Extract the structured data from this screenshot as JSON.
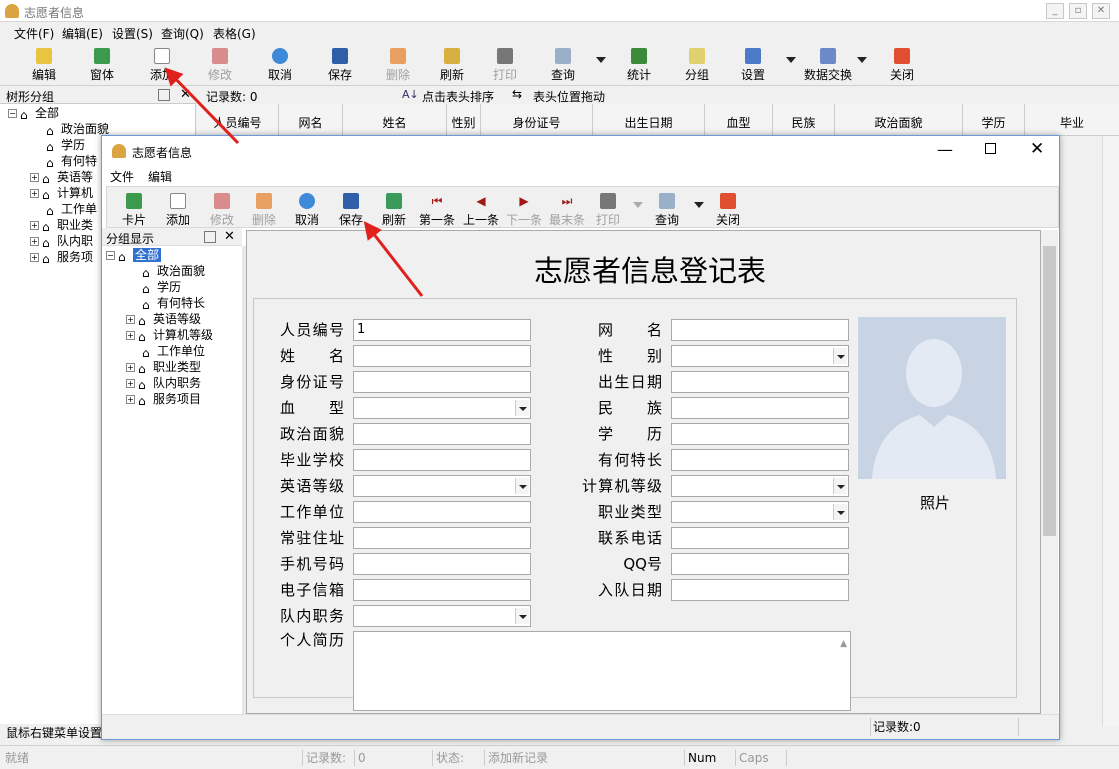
{
  "main_window": {
    "title": "志愿者信息",
    "menu": [
      "文件(F)",
      "编辑(E)",
      "设置(S)",
      "查询(Q)",
      "表格(G)"
    ],
    "toolbar": [
      "编辑",
      "窗体",
      "添加",
      "修改",
      "取消",
      "保存",
      "删除",
      "刷新",
      "打印",
      "查询",
      "统计",
      "分组",
      "设置",
      "数据交换",
      "关闭"
    ],
    "left_panel_title": "树形分组",
    "record_count_label": "记录数: 0",
    "sort_hint": "点击表头排序",
    "drag_hint": "表头位置拖动",
    "tree": [
      "全部",
      "政治面貌",
      "学历",
      "有何特",
      "英语等",
      "计算机",
      "工作单",
      "职业类",
      "队内职",
      "服务项"
    ],
    "columns": [
      "人员编号",
      "网名",
      "姓名",
      "性别",
      "身份证号",
      "出生日期",
      "血型",
      "民族",
      "政治面貌",
      "学历",
      "毕业"
    ],
    "left_footer": "鼠标右键菜单设置",
    "status": {
      "ready": "就绪",
      "records_label": "记录数:",
      "records_value": "0",
      "state_label": "状态:",
      "state_value": "添加新记录",
      "num": "Num",
      "caps": "Caps"
    }
  },
  "child_window": {
    "title": "志愿者信息",
    "menu": [
      "文件",
      "编辑"
    ],
    "toolbar": [
      "卡片",
      "添加",
      "修改",
      "删除",
      "取消",
      "保存",
      "刷新",
      "第一条",
      "上一条",
      "下一条",
      "最末条",
      "打印",
      "查询",
      "关闭"
    ],
    "group_title": "分组显示",
    "tree": [
      "全部",
      "政治面貌",
      "学历",
      "有何特长",
      "英语等级",
      "计算机等级",
      "工作单位",
      "职业类型",
      "队内职务",
      "服务项目"
    ],
    "form_title": "志愿者信息登记表",
    "fields_left": [
      "人员编号",
      "姓名",
      "身份证号",
      "血型",
      "政治面貌",
      "毕业学校",
      "英语等级",
      "工作单位",
      "常驻住址",
      "手机号码",
      "电子信箱",
      "队内职务",
      "个人简历"
    ],
    "fields_right": [
      "网名",
      "性别",
      "出生日期",
      "民族",
      "学历",
      "有何特长",
      "计算机等级",
      "职业类型",
      "联系电话",
      "QQ号",
      "入队日期"
    ],
    "person_id_value": "1",
    "photo_label": "照片",
    "status_records": "记录数:0"
  },
  "colors": {
    "accent_red": "#e0201c",
    "title_blue": "#6a9bd8"
  }
}
